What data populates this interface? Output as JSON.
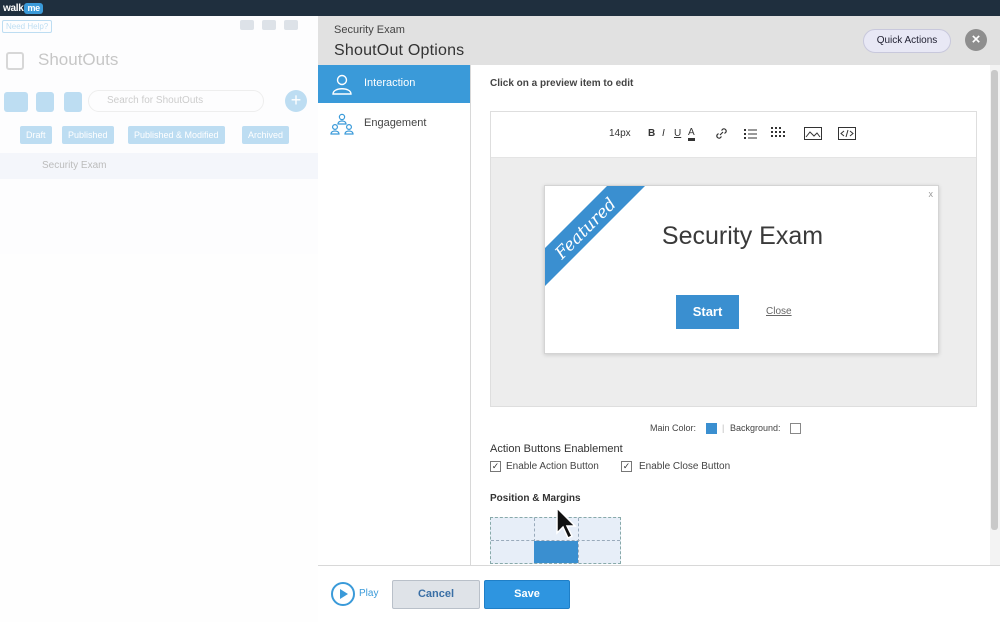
{
  "app": {
    "logo_text": "walk",
    "logo_badge": "me"
  },
  "left_panel": {
    "need_help": "Need Help?",
    "title": "ShoutOuts",
    "search_placeholder": "Search for ShoutOuts",
    "add_label": "+",
    "filters": [
      "Draft",
      "Published",
      "Published & Modified",
      "Archived"
    ],
    "item": "Security Exam"
  },
  "modal": {
    "subtitle": "Security Exam",
    "title": "ShoutOut Options",
    "quick_actions": "Quick Actions",
    "close_label": "×",
    "sidebar": [
      {
        "label": "Interaction",
        "icon": "person-icon",
        "active": true
      },
      {
        "label": "Engagement",
        "icon": "group-icon",
        "active": false
      }
    ],
    "hint": "Click on a preview item to edit",
    "toolbar": {
      "font_size": "14px",
      "bold": "B",
      "italic": "I",
      "underline": "U",
      "color": "A"
    },
    "preview": {
      "ribbon": "Featured",
      "title": "Security Exam",
      "start": "Start",
      "close": "Close",
      "dismiss": "x"
    },
    "colors": {
      "main_label": "Main Color:",
      "main_value": "#3a8fd0",
      "background_label": "Background:",
      "background_value": "#ffffff"
    },
    "action_buttons": {
      "title": "Action Buttons Enablement",
      "enable_action": "Enable Action Button",
      "enable_close": "Enable Close Button",
      "action_checked": "✓",
      "close_checked": "✓"
    },
    "position": {
      "title": "Position & Margins"
    },
    "footer": {
      "play": "Play",
      "cancel": "Cancel",
      "save": "Save"
    }
  },
  "accent_color": "#3a9ad9"
}
